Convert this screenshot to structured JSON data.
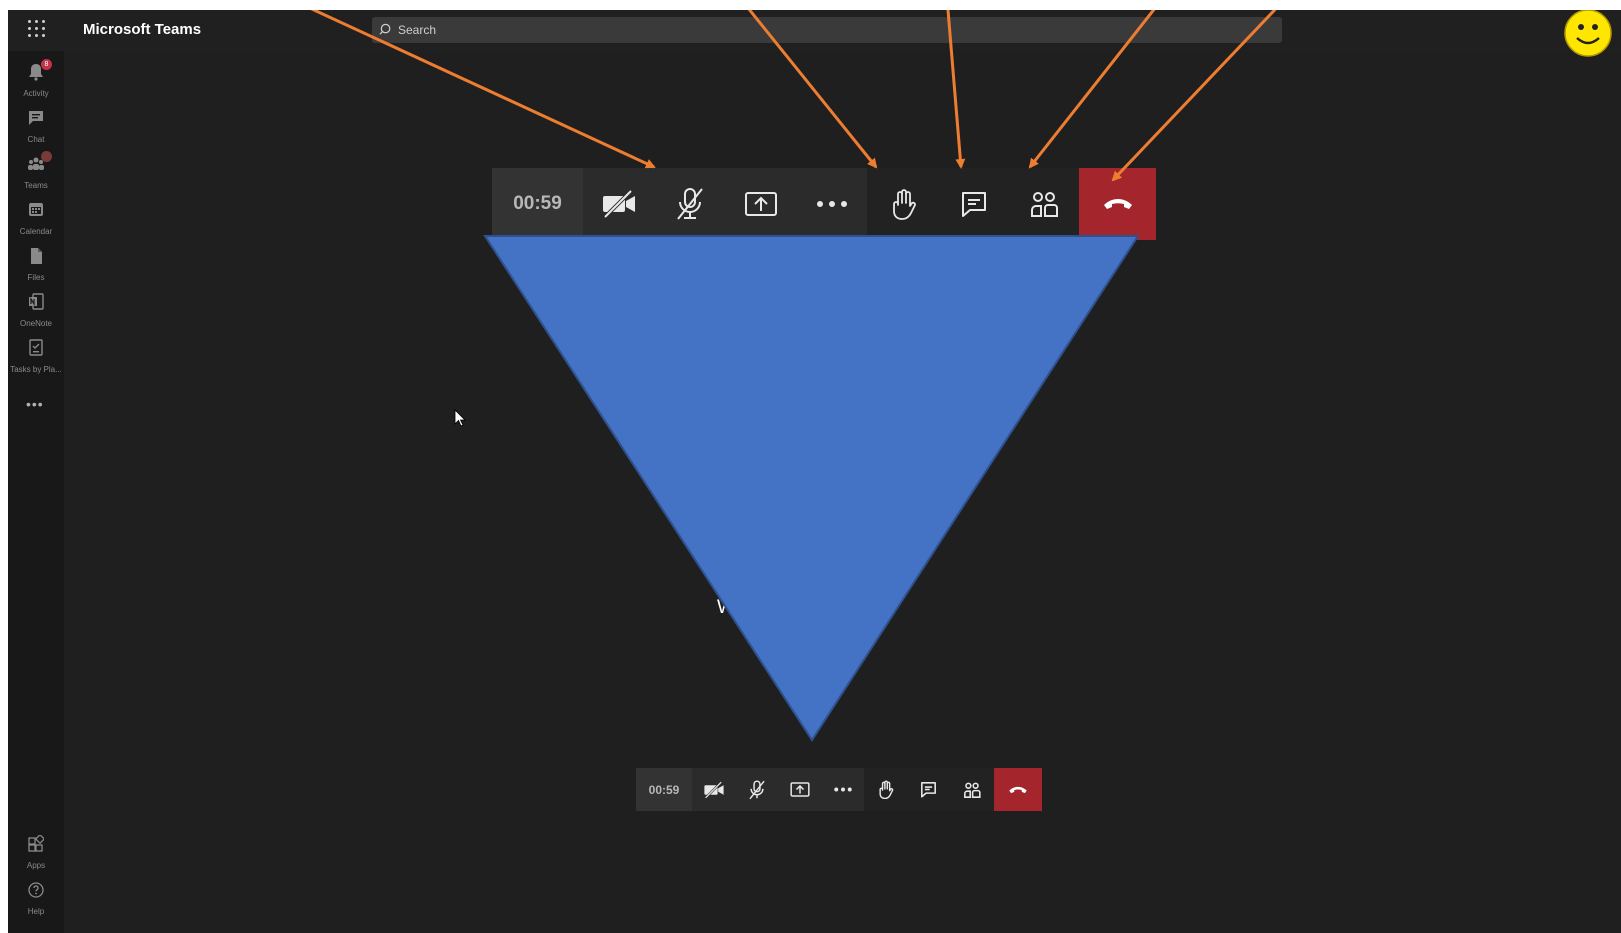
{
  "app": {
    "title": "Microsoft Teams"
  },
  "search": {
    "placeholder": "Search"
  },
  "sidebar": {
    "items": [
      {
        "label": "Activity",
        "icon": "bell-icon",
        "badge": "8"
      },
      {
        "label": "Chat",
        "icon": "chat-icon",
        "badge": ""
      },
      {
        "label": "Teams",
        "icon": "teams-icon",
        "badge": ""
      },
      {
        "label": "Calendar",
        "icon": "calendar-icon",
        "badge": ""
      },
      {
        "label": "Files",
        "icon": "files-icon",
        "badge": ""
      },
      {
        "label": "OneNote",
        "icon": "onenote-icon",
        "badge": ""
      },
      {
        "label": "Tasks by Pla...",
        "icon": "tasks-icon",
        "badge": ""
      }
    ],
    "more": "•••",
    "bottom": [
      {
        "label": "Apps",
        "icon": "apps-icon"
      },
      {
        "label": "Help",
        "icon": "help-icon"
      }
    ]
  },
  "call": {
    "timer": "00:59",
    "waiting_text": "W                      join...",
    "controls": [
      "camera-off-icon",
      "mic-off-icon",
      "share-screen-icon",
      "more-icon",
      "raise-hand-icon",
      "chat-icon",
      "participants-icon",
      "hang-up-icon"
    ]
  },
  "colors": {
    "background": "#1f1f1f",
    "hangup": "#a4262c",
    "triangle": "#4472c4",
    "arrow": "#ed7d31"
  }
}
